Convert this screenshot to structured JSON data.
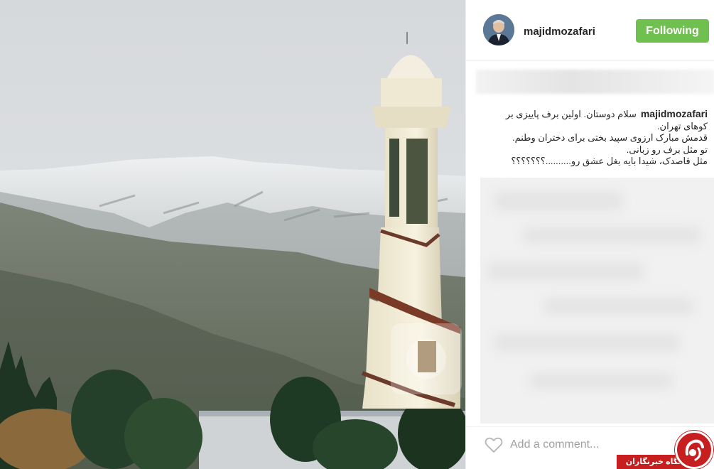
{
  "post": {
    "username": "majidmozafari",
    "follow_label": "Following",
    "caption_lines": [
      "سلام دوستان. اولین برف پاییزی بر",
      "کوهای تهران.",
      "قدمش مبارک ارزوی سپید بختی برای دختران وطنم.",
      "تو مثل برف رو زبانی.",
      "مثل قاصدک، شیدا بایه بغل عشق رو..........؟؟؟؟؟؟؟"
    ],
    "comment_placeholder": "Add a comment..."
  },
  "watermark": {
    "text": "باشگاه خبرنگاران"
  },
  "colors": {
    "follow_button": "#70c050",
    "watermark": "#c71f20"
  },
  "icons": {
    "like": "heart-outline-icon"
  }
}
